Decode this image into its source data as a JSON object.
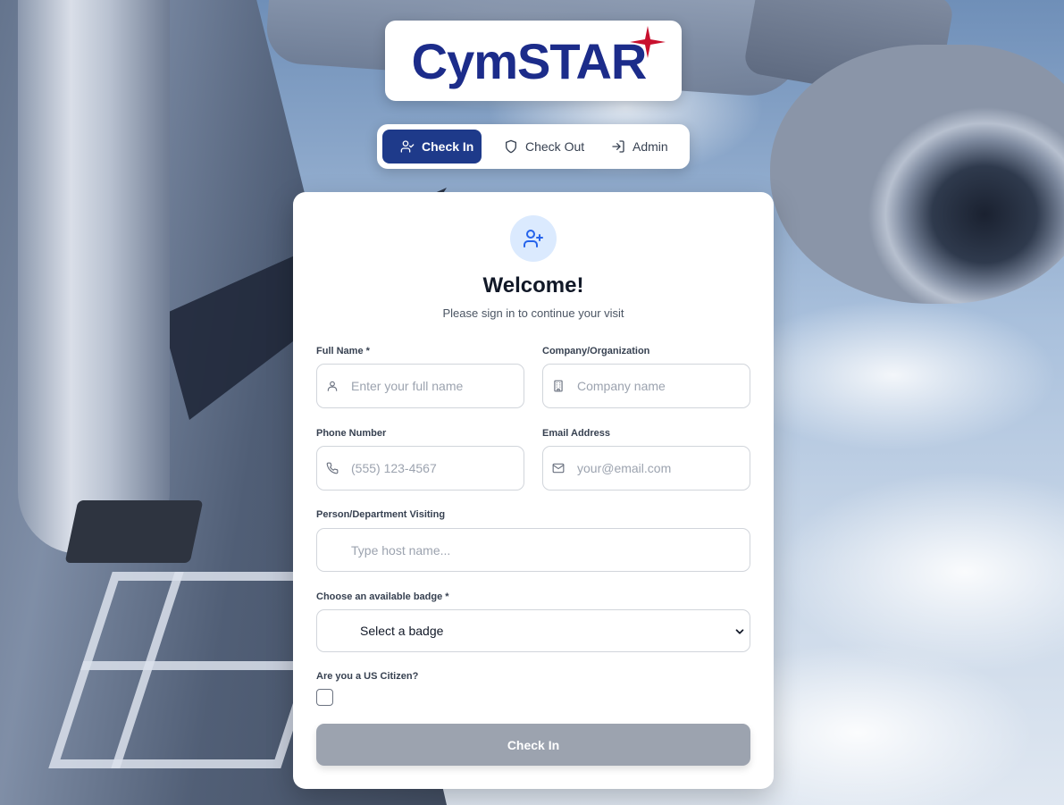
{
  "brand": {
    "logo_text": "CymSTAR",
    "logo_color": "#1c2c8a",
    "star_color": "#c8102e"
  },
  "nav": {
    "tabs": [
      {
        "label": "Check In",
        "icon": "user-check-icon",
        "active": true
      },
      {
        "label": "Check Out",
        "icon": "shield-icon",
        "active": false
      },
      {
        "label": "Admin",
        "icon": "log-in-icon",
        "active": false
      }
    ],
    "active_color": "#1e3a8a"
  },
  "form": {
    "avatar_icon": "user-plus-icon",
    "title": "Welcome!",
    "subtitle": "Please sign in to continue your visit",
    "full_name": {
      "label": "Full Name *",
      "placeholder": "Enter your full name",
      "value": "",
      "icon": "user-icon"
    },
    "company": {
      "label": "Company/Organization",
      "placeholder": "Company name",
      "value": "",
      "icon": "building-icon"
    },
    "phone": {
      "label": "Phone Number",
      "placeholder": "(555) 123-4567",
      "value": "",
      "icon": "phone-icon"
    },
    "email": {
      "label": "Email Address",
      "placeholder": "your@email.com",
      "value": "",
      "icon": "mail-icon"
    },
    "host": {
      "label": "Person/Department Visiting",
      "placeholder": "Type host name...",
      "value": ""
    },
    "badge": {
      "label": "Choose an available badge *",
      "selected": "Select a badge"
    },
    "citizen": {
      "label": "Are you a US Citizen?",
      "checked": false
    },
    "submit_label": "Check In",
    "submit_color": "#9ca3af"
  }
}
